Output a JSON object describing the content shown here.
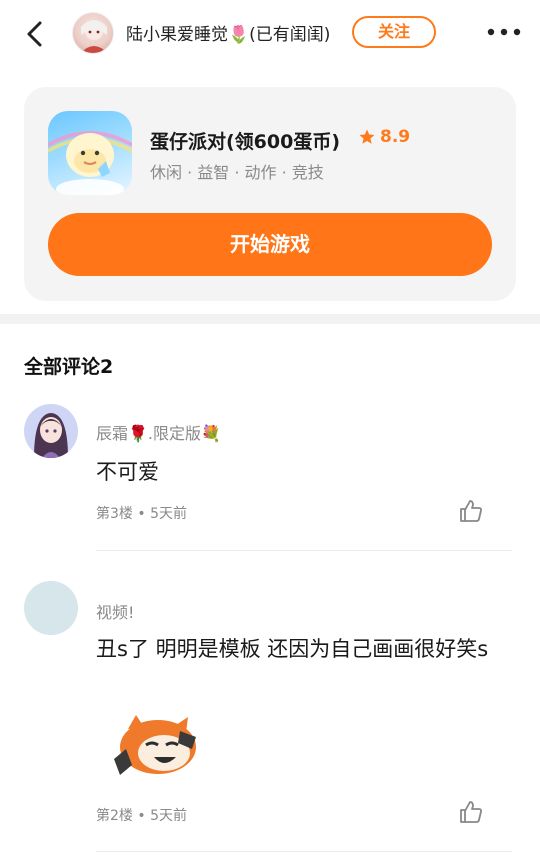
{
  "header": {
    "title": "陆小果爱睡觉🌷(已有闺闺)",
    "follow_label": "关注"
  },
  "game": {
    "name": "蛋仔派对(领600蛋币)",
    "rating": "8.9",
    "tags": "休闲 · 益智 · 动作 · 竞技",
    "start_label": "开始游戏"
  },
  "comments_section": {
    "title": "全部评论2"
  },
  "comments": [
    {
      "user": "辰霜🌹.限定版💐",
      "text": "不可爱",
      "meta": "第3楼 • 5天前"
    },
    {
      "user": "视频!",
      "text": "丑s了 明明是模板 还因为自己画画很好笑s",
      "meta": "第2楼 • 5天前"
    }
  ],
  "colors": {
    "accent": "#ff7517",
    "muted_text": "#8a8a8a",
    "card_bg": "#f4f4f5"
  },
  "icons": [
    "back-arrow-icon",
    "more-dots-icon",
    "star-icon",
    "thumbs-up-icon"
  ]
}
